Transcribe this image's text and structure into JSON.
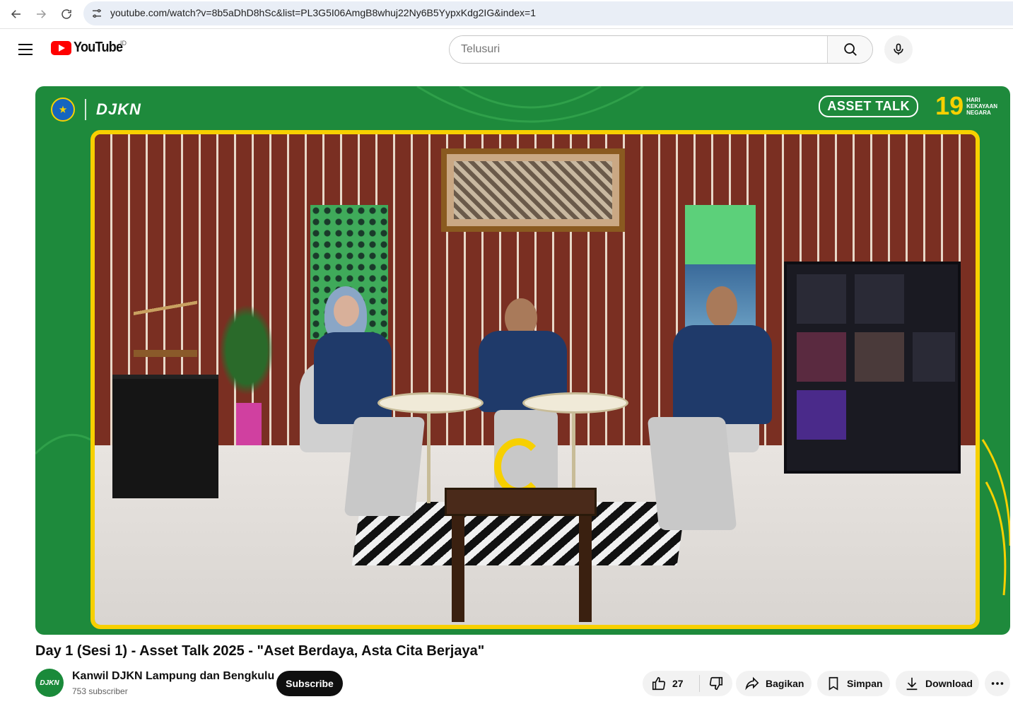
{
  "browser": {
    "url": "youtube.com/watch?v=8b5aDhD8hSc&list=PL3G5I06AmgB8whuj22Ny6B5YypxKdg2IG&index=1"
  },
  "header": {
    "logo_text": "YouTube",
    "region_code": "ID",
    "search_placeholder": "Telusuri"
  },
  "video": {
    "overlay_brand": "DJKN",
    "overlay_asset_talk": "ASSET TALK",
    "overlay_anniversary_number": "19",
    "overlay_anniversary_text_1": "HARI",
    "overlay_anniversary_text_2": "KEKAYAAN",
    "overlay_anniversary_text_3": "NEGARA",
    "title": "Day 1 (Sesi 1) - Asset Talk 2025 - \"Aset Berdaya, Asta Cita Berjaya\""
  },
  "channel": {
    "avatar_text": "DJKN",
    "name": "Kanwil DJKN Lampung dan Bengkulu",
    "subscribers": "753 subscriber",
    "subscribe_label": "Subscribe"
  },
  "actions": {
    "like_count": "27",
    "share_label": "Bagikan",
    "save_label": "Simpan",
    "download_label": "Download"
  },
  "colors": {
    "brand_red": "#ff0000",
    "overlay_green": "#1e8a3c",
    "frame_yellow": "#f7d000"
  }
}
